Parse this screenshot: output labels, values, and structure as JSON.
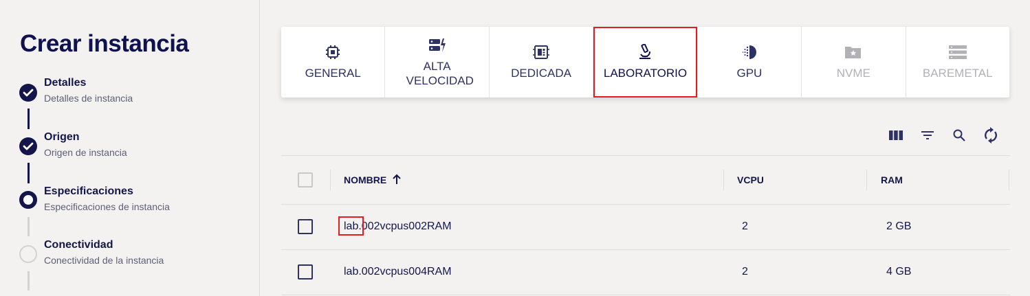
{
  "sidebar": {
    "title": "Crear instancia",
    "steps": [
      {
        "title": "Detalles",
        "subtitle": "Detalles de instancia",
        "state": "done"
      },
      {
        "title": "Origen",
        "subtitle": "Origen de instancia",
        "state": "done"
      },
      {
        "title": "Especificaciones",
        "subtitle": "Especificaciones de instancia",
        "state": "current"
      },
      {
        "title": "Conectividad",
        "subtitle": "Conectividad de la instancia",
        "state": "todo"
      }
    ]
  },
  "tabs": [
    {
      "label": "GENERAL",
      "icon": "chip-icon"
    },
    {
      "label": "ALTA VELOCIDAD",
      "icon": "server-bolt-icon"
    },
    {
      "label": "DEDICADA",
      "icon": "dedicated-chip-icon"
    },
    {
      "label": "LABORATORIO",
      "icon": "microscope-icon",
      "selected": true
    },
    {
      "label": "GPU",
      "icon": "gpu-icon"
    },
    {
      "label": "NVME",
      "icon": "star-folder-icon",
      "disabled": true
    },
    {
      "label": "BAREMETAL",
      "icon": "server-stack-icon",
      "disabled": true
    }
  ],
  "toolbar": {
    "icons": [
      "columns-icon",
      "filter-icon",
      "search-icon",
      "refresh-icon"
    ]
  },
  "table": {
    "columns": {
      "name": "NOMBRE",
      "vcpu": "VCPU",
      "ram": "RAM"
    },
    "sort": "asc",
    "rows": [
      {
        "name": "lab.002vcpus002RAM",
        "vcpu": "2",
        "ram": "2 GB"
      },
      {
        "name": "lab.002vcpus004RAM",
        "vcpu": "2",
        "ram": "4 GB"
      }
    ]
  },
  "colors": {
    "primary": "#14154a",
    "highlight": "#e31b23",
    "background": "#f3f2f0"
  }
}
